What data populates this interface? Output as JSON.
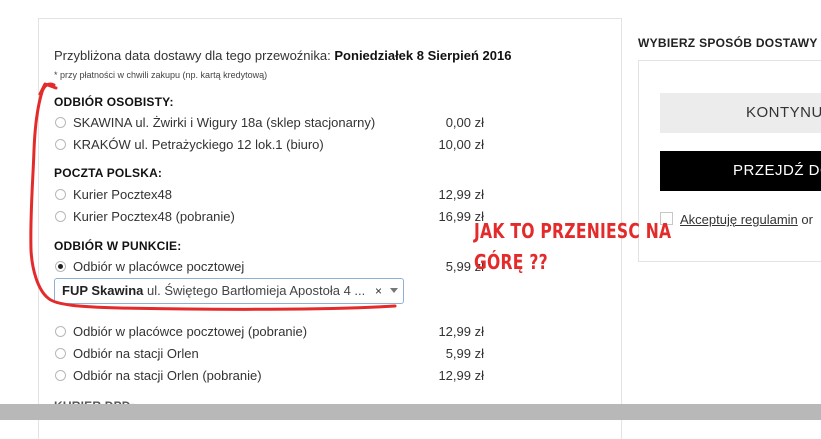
{
  "delivery": {
    "eta_label": "Przybliżona data dostawy dla tego przewoźnika:",
    "eta_date": "Poniedziałek 8 Sierpień 2016",
    "note": "* przy płatności w chwili zakupu (np. kartą kredytową)"
  },
  "sections": [
    {
      "title": "ODBIÓR OSOBISTY:",
      "options": [
        {
          "label": "SKAWINA ul. Żwirki i Wigury 18a (sklep stacjonarny)",
          "price": "0,00 zł",
          "checked": false
        },
        {
          "label": "KRAKÓW ul. Petrażyckiego 12 lok.1 (biuro)",
          "price": "10,00 zł",
          "checked": false
        }
      ]
    },
    {
      "title": "POCZTA POLSKA:",
      "options": [
        {
          "label": "Kurier Pocztex48",
          "price": "12,99 zł",
          "checked": false
        },
        {
          "label": "Kurier Pocztex48 (pobranie)",
          "price": "16,99 zł",
          "checked": false
        }
      ]
    },
    {
      "title": "ODBIÓR W PUNKCIE:",
      "options": [
        {
          "label": "Odbiór w placówce pocztowej",
          "price": "5,99 zł",
          "checked": true
        },
        {
          "label": "Odbiór w placówce pocztowej (pobranie)",
          "price": "12,99 zł",
          "checked": false
        },
        {
          "label": "Odbiór na stacji Orlen",
          "price": "5,99 zł",
          "checked": false
        },
        {
          "label": "Odbiór na stacji Orlen (pobranie)",
          "price": "12,99 zł",
          "checked": false
        }
      ]
    },
    {
      "title": "KURIER DPD:"
    }
  ],
  "post_office_select": {
    "selected_bold": "FUP Skawina",
    "selected_rest": " ul. Świętego Bartłomieja Apostoła 4 ...",
    "clear_glyph": "×"
  },
  "sidebar": {
    "title": "WYBIERZ SPOSÓB DOSTAWY",
    "continue_label": "KONTYNUUJ",
    "proceed_label": "PRZEJDŹ DO",
    "terms_label": "Akceptuję regulamin",
    "terms_suffix": " or"
  },
  "annotation": {
    "line1": "JAK TO PRZENIESC NA",
    "line2": "GÓRĘ ??",
    "color": "#e32b2b"
  }
}
